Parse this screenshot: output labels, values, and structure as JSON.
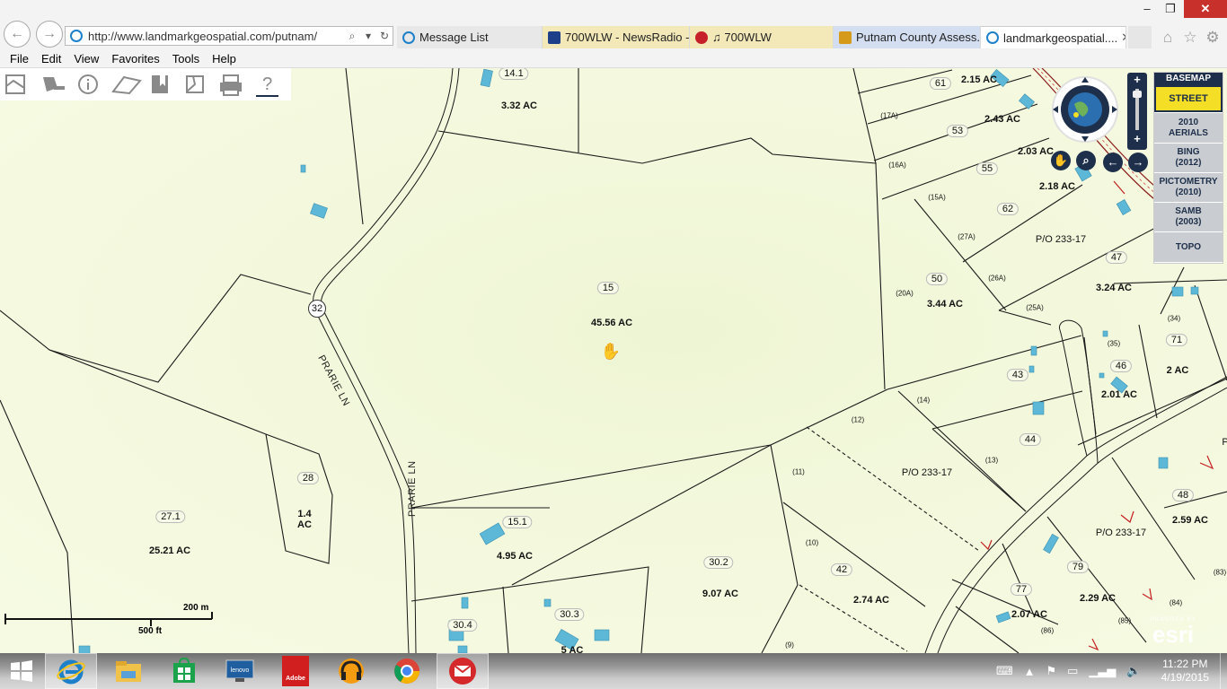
{
  "browser": {
    "url": "http://www.landmarkgeospatial.com/putnam/",
    "tabs": [
      {
        "label": "Message List",
        "color": "#1e80c9"
      },
      {
        "label": "700WLW - NewsRadio -...",
        "color": "#1d3f8a"
      },
      {
        "label": "♫ 700WLW",
        "color": "#c6202a"
      },
      {
        "label": "Putnam County Assess...",
        "color": "#d59a1a"
      },
      {
        "label": "landmarkgeospatial....",
        "color": "#1e80c9"
      }
    ],
    "active_tab": 4,
    "window_controls": {
      "minimize": "–",
      "restore": "❐",
      "close": "✕"
    },
    "right_icons": [
      "home-icon",
      "star-icon",
      "gear-icon"
    ]
  },
  "menu": [
    "File",
    "Edit",
    "View",
    "Favorites",
    "Tools",
    "Help"
  ],
  "map_tools": [
    "layers-tool-icon",
    "search-tool-icon",
    "identify-tool-icon",
    "measure-tool-icon",
    "bookmark-tool-icon",
    "draw-tool-icon",
    "print-tool-icon",
    "help-tool-icon"
  ],
  "basemap": {
    "header": "BASEMAP",
    "options": [
      "STREET",
      "2010\nAERIALS",
      "BING\n(2012)",
      "PICTOMETRY\n(2010)",
      "SAMB\n(2003)",
      "TOPO"
    ],
    "selected": 0
  },
  "map_labels": {
    "acreage": [
      "3.32 AC",
      "45.56 AC",
      "2.15 AC",
      "2.43 AC",
      "2.03 AC",
      "2.18 AC",
      "3.44 AC",
      "3.24 AC",
      "2 AC",
      "2.01 AC",
      "1.4\nAC",
      "25.21 AC",
      "4.95 AC",
      "9.07 AC",
      "2.74 AC",
      "2.59 AC",
      "2.29 AC",
      "2.07 AC",
      "5 AC"
    ],
    "parcel_numbers": [
      "14.1",
      "15",
      "61",
      "53",
      "55",
      "62",
      "47",
      "50",
      "43",
      "46",
      "71",
      "44",
      "28",
      "27.1",
      "15.1",
      "30.2",
      "42",
      "48",
      "79",
      "77",
      "30.4",
      "30.3"
    ],
    "sub_parcels": [
      "(17A)",
      "(16A)",
      "(15A)",
      "(27A)",
      "(26A)",
      "(25A)",
      "(20A)",
      "(35)",
      "(34)",
      "(14)",
      "(12)",
      "(13)",
      "(11)",
      "(10)",
      "(9)",
      "(83)",
      "(84)",
      "(85)",
      "(86)"
    ],
    "other": [
      "P/O 233-17",
      "P/O 233-17",
      "P/O 233-17",
      "P"
    ],
    "road_name": "PRARIE LN",
    "road_number": "32"
  },
  "scale": {
    "metric": "200 m",
    "imperial": "500 ft"
  },
  "esri": {
    "powered": "POWERED BY",
    "logo": "esri"
  },
  "taskbar": {
    "apps": [
      "start-button",
      "internet-explorer-icon",
      "file-explorer-icon",
      "store-icon",
      "lenovo-icon",
      "adobe-icon",
      "audible-icon",
      "chrome-icon",
      "mail-icon"
    ],
    "adobe_label": "Adobe",
    "time": "11:22 PM",
    "date": "4/19/2015"
  }
}
